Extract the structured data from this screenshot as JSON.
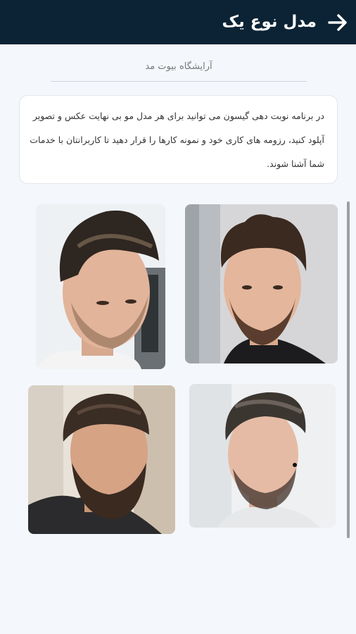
{
  "header": {
    "title": "مدل نوع یک",
    "back_icon": "arrow-right-icon"
  },
  "salon_name": "آرایشگاه بیوت مد",
  "description": "در برنامه نوبت دهی گیسون می توانید برای هر مدل مو بی نهایت عکس و تصویر آپلود کنید، رزومه های کاری خود و نمونه کارها را قرار دهید تا کاربرانتان با خدمات شما آشنا شوند.",
  "gallery": {
    "images": [
      "haircut-photo-1",
      "haircut-photo-2",
      "haircut-photo-3",
      "haircut-photo-4"
    ]
  },
  "colors": {
    "header_bg": "#0b2335",
    "page_bg": "#f4f7fb"
  }
}
